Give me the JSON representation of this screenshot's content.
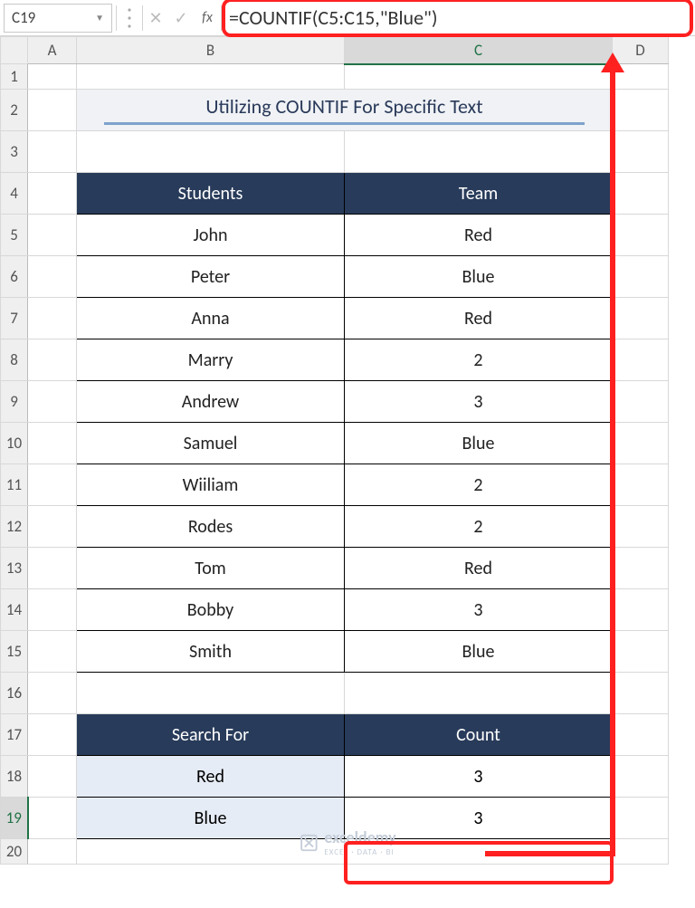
{
  "nameBox": "C19",
  "formula": "=COUNTIF(C5:C15,\"Blue\")",
  "cols": [
    "A",
    "B",
    "C",
    "D"
  ],
  "rows": [
    "1",
    "2",
    "3",
    "4",
    "5",
    "6",
    "7",
    "8",
    "9",
    "10",
    "11",
    "12",
    "13",
    "14",
    "15",
    "16",
    "17",
    "18",
    "19",
    "20"
  ],
  "title": "Utilizing COUNTIF For Specific Text",
  "table": {
    "headers": {
      "students": "Students",
      "team": "Team"
    },
    "rows": [
      {
        "student": "John",
        "team": "Red"
      },
      {
        "student": "Peter",
        "team": "Blue"
      },
      {
        "student": "Anna",
        "team": "Red"
      },
      {
        "student": "Marry",
        "team": "2"
      },
      {
        "student": "Andrew",
        "team": "3"
      },
      {
        "student": "Samuel",
        "team": "Blue"
      },
      {
        "student": "Wiiliam",
        "team": "2"
      },
      {
        "student": "Rodes",
        "team": "2"
      },
      {
        "student": "Tom",
        "team": "Red"
      },
      {
        "student": "Bobby",
        "team": "3"
      },
      {
        "student": "Smith",
        "team": "Blue"
      }
    ]
  },
  "search": {
    "headers": {
      "for": "Search For",
      "count": "Count"
    },
    "rows": [
      {
        "label": "Red",
        "count": "3"
      },
      {
        "label": "Blue",
        "count": "3"
      }
    ]
  },
  "watermark": {
    "name": "exceldemy",
    "sub": "EXCEL · DATA · BI"
  },
  "selectedRow": "19",
  "selectedCol": "C"
}
